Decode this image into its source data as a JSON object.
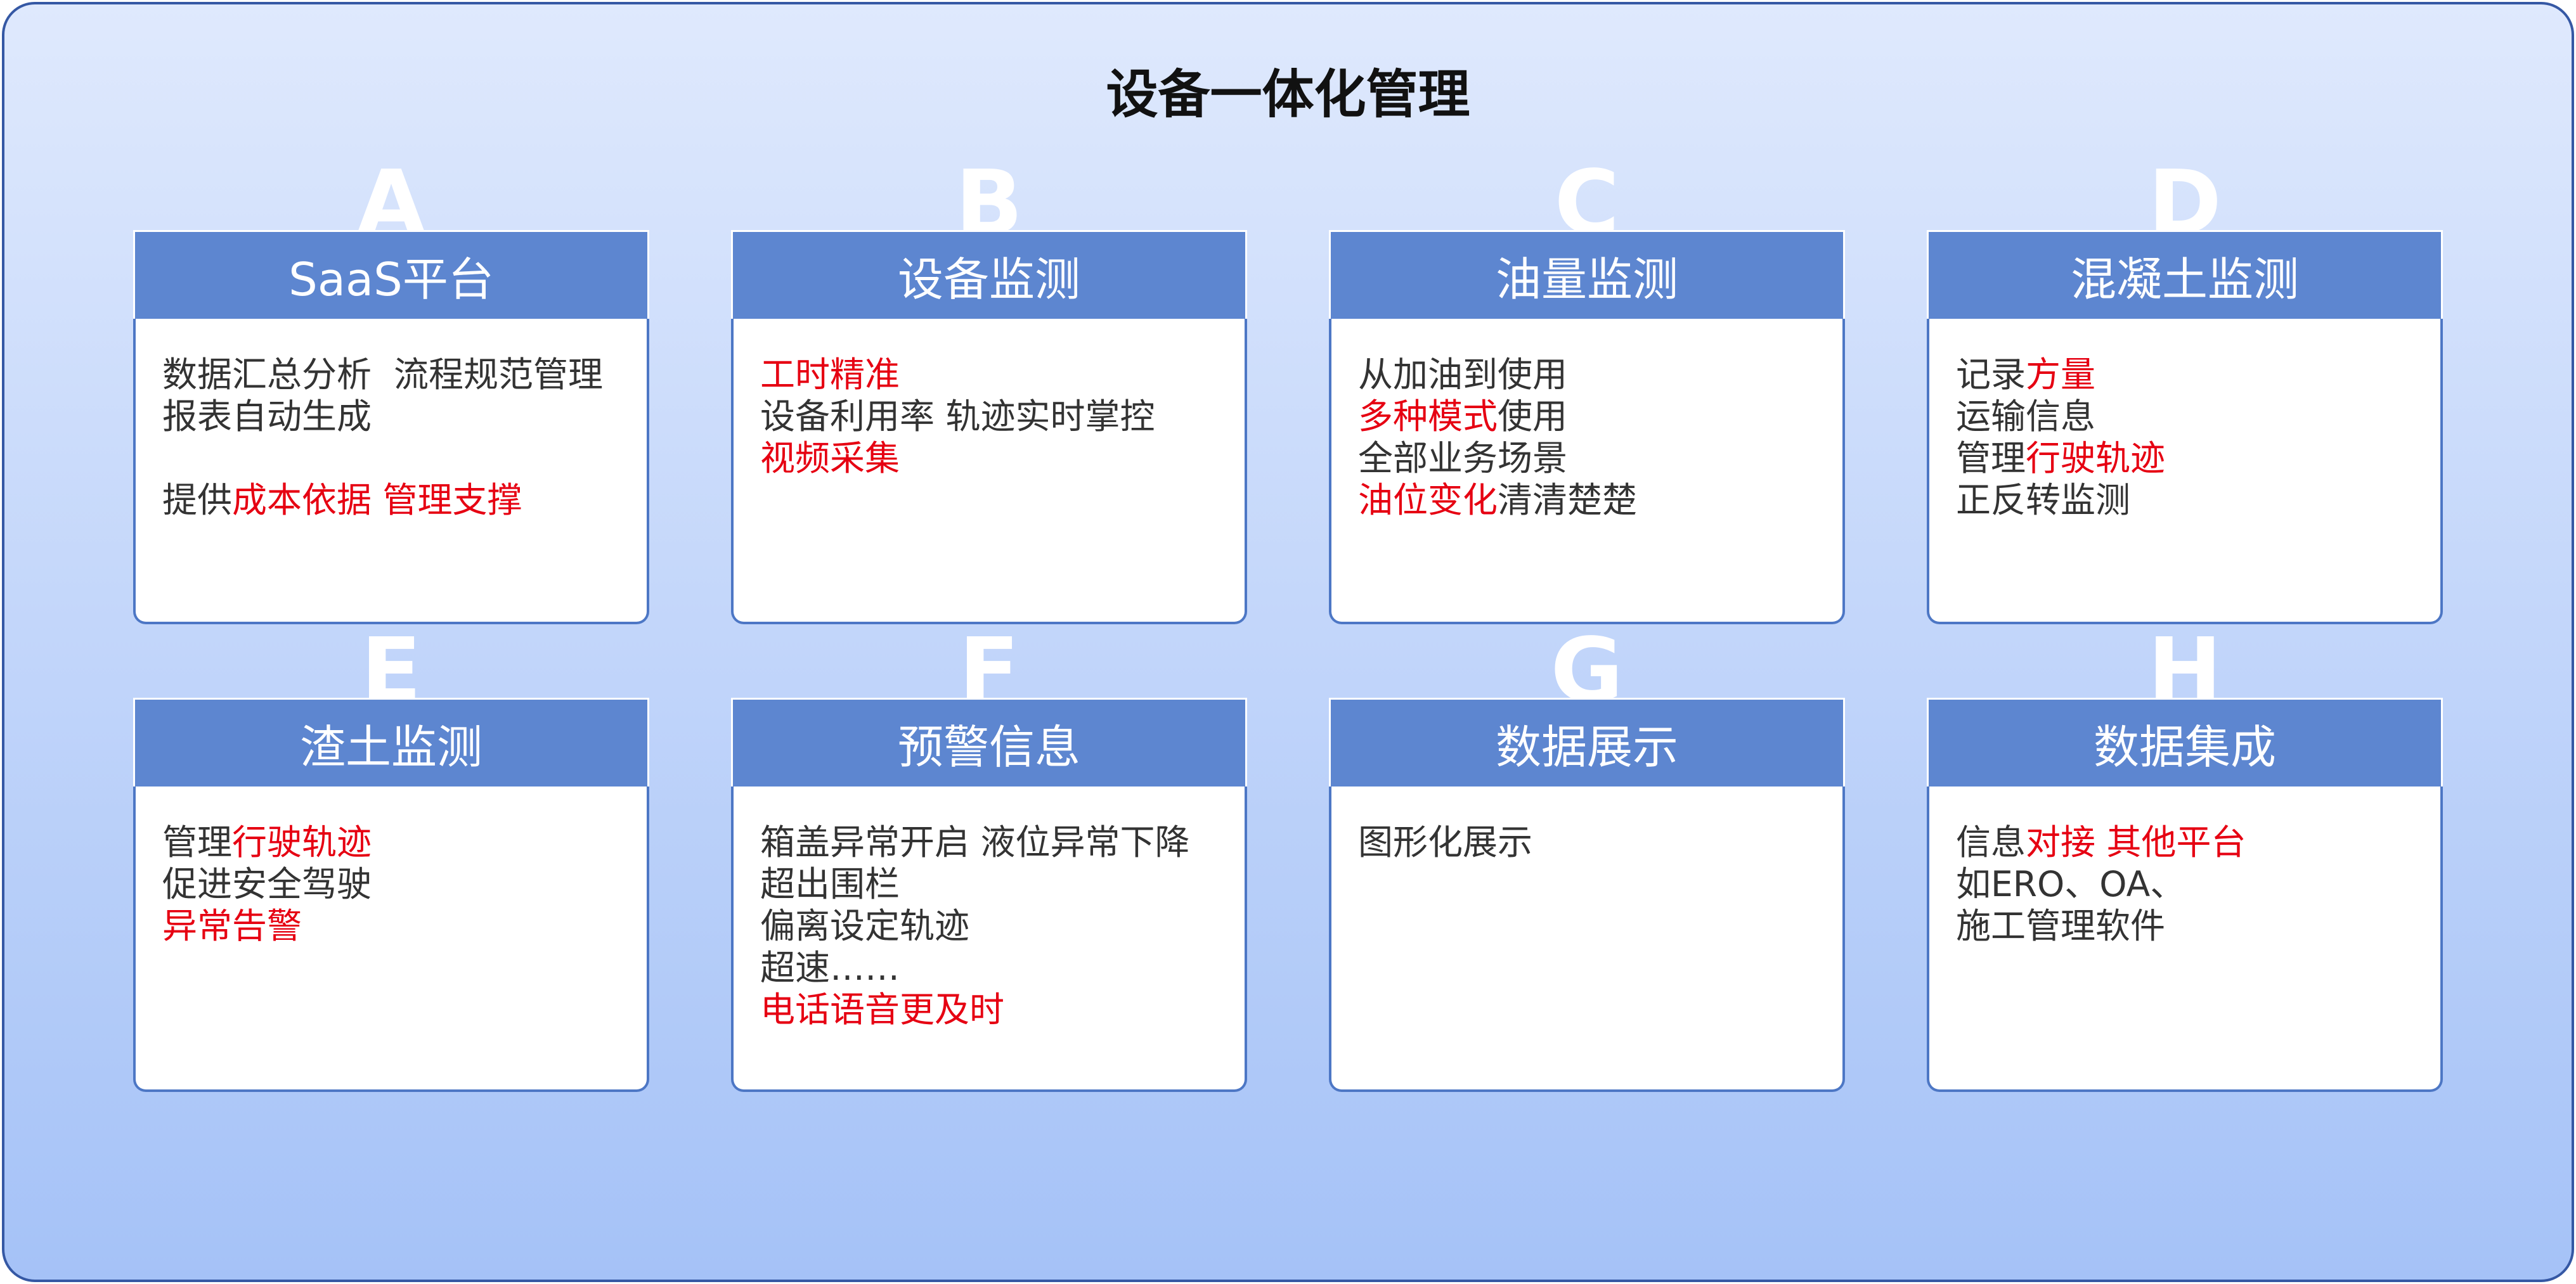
{
  "title": "设备一体化管理",
  "colors": {
    "frame_border": "#3558a4",
    "background_top": "#dfe9fd",
    "background_bottom": "#a5c2f7",
    "header": "#5d86d0",
    "card_border": "#4d77c5",
    "title_text": "#111111",
    "body_text": "#333333",
    "highlight_text": "#e60012",
    "letter": "#ffffff"
  },
  "cards": [
    {
      "letter": "A",
      "title": "SaaS平台",
      "paragraphs": [
        [
          [
            {
              "text": "数据汇总分析  流程规范管理",
              "highlight": false
            }
          ],
          [
            {
              "text": "报表自动生成",
              "highlight": false
            }
          ]
        ],
        [
          [
            {
              "text": "提供",
              "highlight": false
            },
            {
              "text": "成本依据 管理支撑",
              "highlight": true
            }
          ]
        ]
      ]
    },
    {
      "letter": "B",
      "title": "设备监测",
      "paragraphs": [
        [
          [
            {
              "text": "工时精准",
              "highlight": true
            }
          ],
          [
            {
              "text": "设备利用率 轨迹实时掌控",
              "highlight": false
            }
          ],
          [
            {
              "text": "视频采集",
              "highlight": true
            }
          ]
        ]
      ]
    },
    {
      "letter": "C",
      "title": "油量监测",
      "paragraphs": [
        [
          [
            {
              "text": "从加油到使用",
              "highlight": false
            }
          ],
          [
            {
              "text": "多种模式",
              "highlight": true
            },
            {
              "text": "使用",
              "highlight": false
            }
          ],
          [
            {
              "text": "全部业务场景",
              "highlight": false
            }
          ],
          [
            {
              "text": "油位变化",
              "highlight": true
            },
            {
              "text": "清清楚楚",
              "highlight": false
            }
          ]
        ]
      ]
    },
    {
      "letter": "D",
      "title": "混凝土监测",
      "paragraphs": [
        [
          [
            {
              "text": "记录",
              "highlight": false
            },
            {
              "text": "方量",
              "highlight": true
            }
          ],
          [
            {
              "text": "运输信息",
              "highlight": false
            }
          ],
          [
            {
              "text": "管理",
              "highlight": false
            },
            {
              "text": "行驶轨迹",
              "highlight": true
            }
          ],
          [
            {
              "text": "正反转监测",
              "highlight": false
            }
          ]
        ]
      ]
    },
    {
      "letter": "E",
      "title": "渣土监测",
      "paragraphs": [
        [
          [
            {
              "text": "管理",
              "highlight": false
            },
            {
              "text": "行驶轨迹",
              "highlight": true
            }
          ],
          [
            {
              "text": "促进安全驾驶",
              "highlight": false
            }
          ],
          [
            {
              "text": "异常告警",
              "highlight": true
            }
          ]
        ]
      ]
    },
    {
      "letter": "F",
      "title": "预警信息",
      "paragraphs": [
        [
          [
            {
              "text": "箱盖异常开启 液位异常下降",
              "highlight": false
            }
          ],
          [
            {
              "text": "超出围栏",
              "highlight": false
            }
          ],
          [
            {
              "text": "偏离设定轨迹",
              "highlight": false
            }
          ],
          [
            {
              "text": "超速……",
              "highlight": false
            }
          ],
          [
            {
              "text": "电话语音更及时",
              "highlight": true
            }
          ]
        ]
      ]
    },
    {
      "letter": "G",
      "title": "数据展示",
      "paragraphs": [
        [
          [
            {
              "text": "图形化展示",
              "highlight": false
            }
          ]
        ]
      ]
    },
    {
      "letter": "H",
      "title": "数据集成",
      "paragraphs": [
        [
          [
            {
              "text": "信息",
              "highlight": false
            },
            {
              "text": "对接 其他平台",
              "highlight": true
            }
          ],
          [
            {
              "text": "如ERO、OA、",
              "highlight": false
            }
          ],
          [
            {
              "text": "施工管理软件",
              "highlight": false
            }
          ]
        ]
      ]
    }
  ]
}
